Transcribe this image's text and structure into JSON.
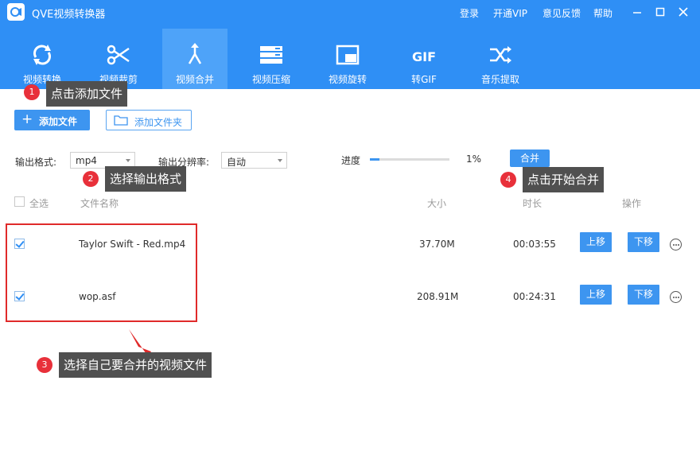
{
  "app": {
    "title": "QVE视频转换器",
    "menu": [
      "登录",
      "开通VIP",
      "意见反馈",
      "帮助"
    ],
    "accent": "#2f8ff5"
  },
  "tabs": [
    {
      "label": "视频转换",
      "icon": "sync-icon",
      "active": false
    },
    {
      "label": "视频裁剪",
      "icon": "scissors-icon",
      "active": false
    },
    {
      "label": "视频合并",
      "icon": "merge-icon",
      "active": true
    },
    {
      "label": "视频压缩",
      "icon": "compress-icon",
      "active": false
    },
    {
      "label": "视频旋转",
      "icon": "rotate-icon",
      "active": false
    },
    {
      "label": "转GIF",
      "icon": "gif-icon",
      "active": false
    },
    {
      "label": "音乐提取",
      "icon": "shuffle-icon",
      "active": false
    }
  ],
  "toolbar": {
    "add_file": "添加文件",
    "add_folder": "添加文件夹",
    "output_format_label": "输出格式:",
    "output_format_value": "mp4",
    "resolution_label": "输出分辨率:",
    "resolution_value": "自动",
    "progress_label": "进度",
    "progress_value": "1%",
    "progress_fraction": 0.12,
    "merge_button": "合并"
  },
  "table": {
    "headers": {
      "select_all": "全选",
      "name": "文件名称",
      "size": "大小",
      "duration": "时长",
      "actions": "操作"
    },
    "rows": [
      {
        "checked": true,
        "name": "Taylor Swift - Red.mp4",
        "size": "37.70M",
        "duration": "00:03:55",
        "up": "上移",
        "down": "下移"
      },
      {
        "checked": true,
        "name": "wop.asf",
        "size": "208.91M",
        "duration": "00:24:31",
        "up": "上移",
        "down": "下移"
      }
    ]
  },
  "annotations": [
    {
      "num": "1",
      "text": "点击添加文件"
    },
    {
      "num": "2",
      "text": "选择输出格式"
    },
    {
      "num": "3",
      "text": "选择自己要合并的视频文件"
    },
    {
      "num": "4",
      "text": "点击开始合并"
    }
  ]
}
